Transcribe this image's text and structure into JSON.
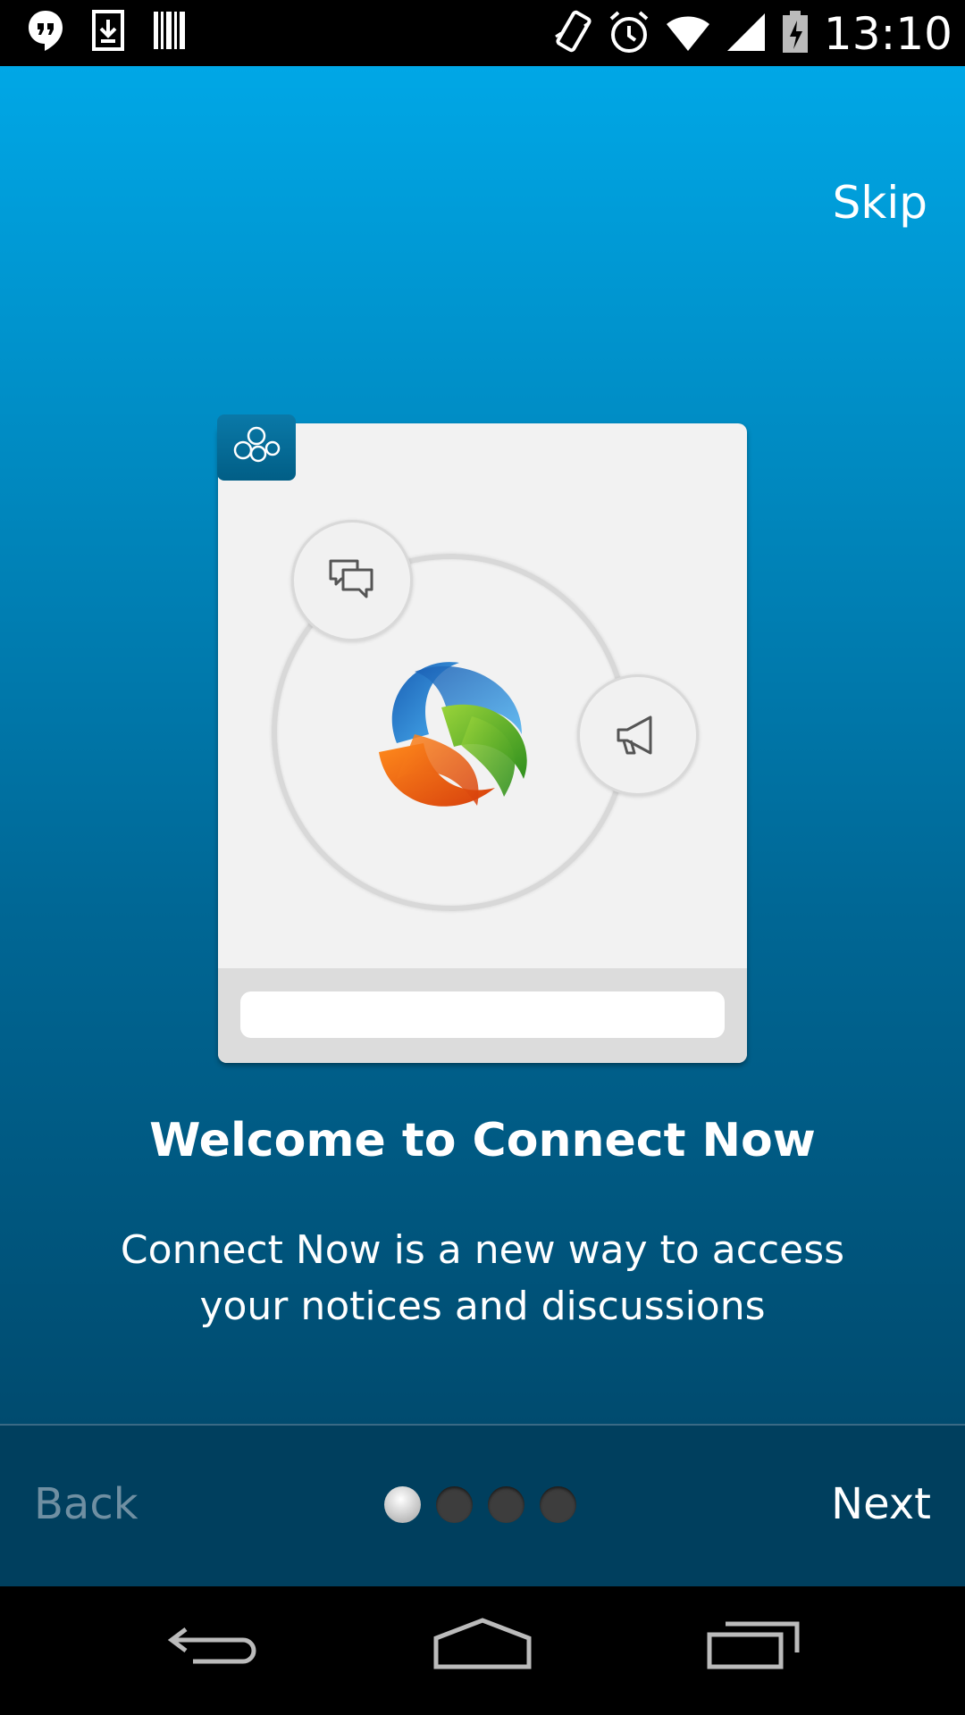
{
  "status_bar": {
    "time": "13:10",
    "left_icons": [
      "hangouts-icon",
      "download-icon",
      "barcode-icon"
    ],
    "right_icons": [
      "vibrate-icon",
      "alarm-icon",
      "wifi-icon",
      "signal-icon",
      "battery-icon"
    ]
  },
  "header": {
    "skip_label": "Skip"
  },
  "illustration": {
    "badge_icon": "connect-network-icon",
    "node_icons": [
      "chat-bubbles-icon",
      "megaphone-icon"
    ],
    "center_logo": "connect-now-logo"
  },
  "welcome": {
    "title": "Welcome to Connect Now",
    "line1": "Connect Now is a new way to access",
    "line2": "your notices and discussions"
  },
  "footer": {
    "back_label": "Back",
    "next_label": "Next",
    "page_count": 4,
    "active_page": 1
  },
  "nav_bar": {
    "buttons": [
      "back-icon",
      "home-icon",
      "recents-icon"
    ]
  },
  "colors": {
    "accent_top": "#00a7e6",
    "accent_bottom": "#004b6f",
    "bottom_bar": "#003f5e"
  }
}
